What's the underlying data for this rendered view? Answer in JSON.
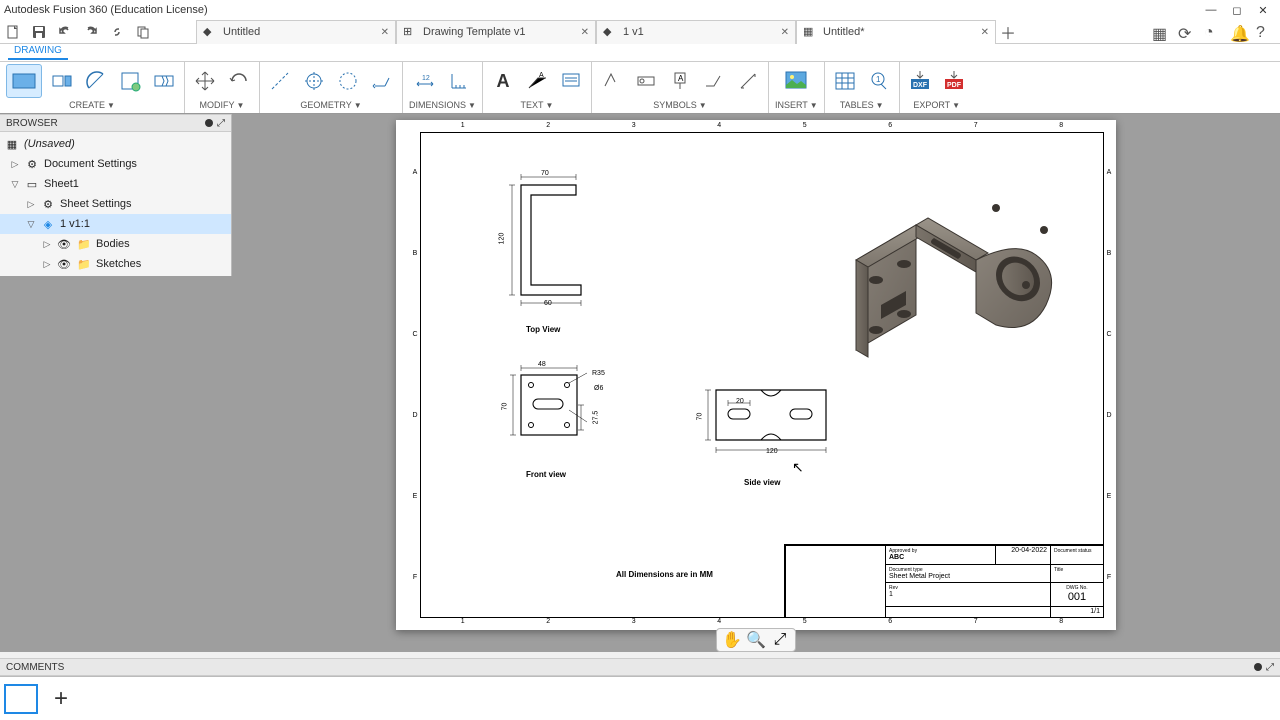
{
  "app": {
    "title": "Autodesk Fusion 360 (Education License)"
  },
  "window_tabs": [
    {
      "label": "Untitled",
      "icon": "fusion"
    },
    {
      "label": "Drawing Template v1",
      "icon": "template"
    },
    {
      "label": "1 v1",
      "icon": "fusion"
    },
    {
      "label": "Untitled*",
      "icon": "drawing",
      "active": true
    }
  ],
  "ribbon": {
    "tab": "DRAWING",
    "groups": {
      "create": "CREATE",
      "modify": "MODIFY",
      "geometry": "GEOMETRY",
      "dimensions": "DIMENSIONS",
      "text": "TEXT",
      "symbols": "SYMBOLS",
      "insert": "INSERT",
      "tables": "TABLES",
      "export": "EXPORT"
    }
  },
  "browser": {
    "title": "BROWSER",
    "root": "(Unsaved)",
    "doc_settings": "Document Settings",
    "sheet1": "Sheet1",
    "sheet_settings": "Sheet Settings",
    "view": "1 v1:1",
    "bodies": "Bodies",
    "sketches": "Sketches"
  },
  "drawing": {
    "ruler_h": [
      "1",
      "2",
      "3",
      "4",
      "5",
      "6",
      "7",
      "8"
    ],
    "ruler_v": [
      "A",
      "B",
      "C",
      "D",
      "E",
      "F"
    ],
    "top_view": {
      "label": "Top View",
      "w": "70",
      "h": "120",
      "base": "60"
    },
    "front_view": {
      "label": "Front view",
      "w": "48",
      "h": "70",
      "r": "R35",
      "slot": "27.5",
      "dia": "Ø6"
    },
    "side_view": {
      "label": "Side view",
      "w": "120",
      "h": "70",
      "slot": "20"
    },
    "note": "All Dimensions are in MM",
    "titleblock": {
      "approved": "ABC",
      "date": "20-04-2022",
      "doc_type_lbl": "Document type",
      "status_lbl": "Document status",
      "title": "Sheet Metal Project",
      "dwg_no_lbl": "DWG No.",
      "dwg_no": "001",
      "rev": "1",
      "sheet": "1/1"
    }
  },
  "comments": {
    "title": "COMMENTS"
  }
}
